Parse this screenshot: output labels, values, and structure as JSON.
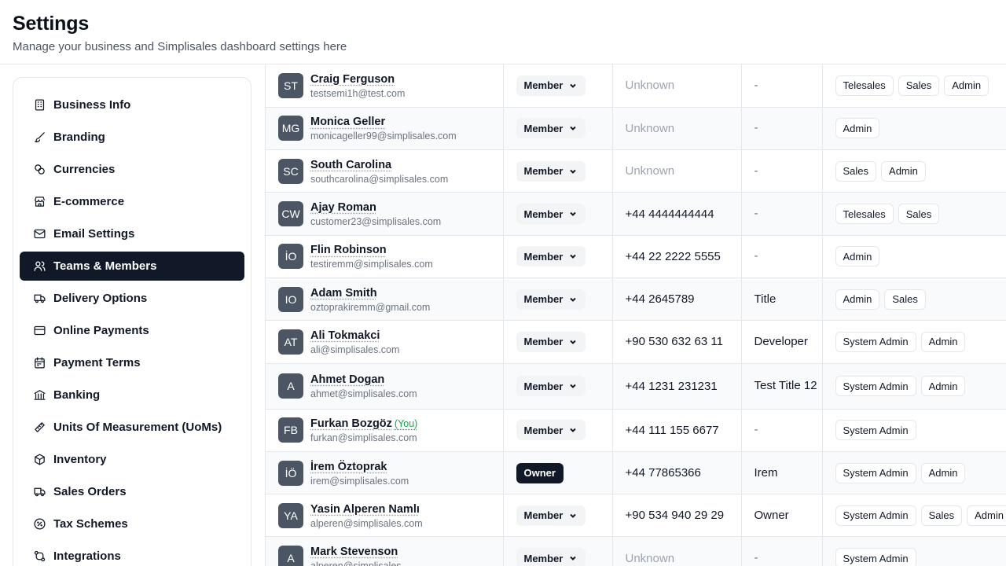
{
  "header": {
    "title": "Settings",
    "subtitle": "Manage your business and Simplisales dashboard settings here"
  },
  "sidebar": {
    "items": [
      {
        "label": "Business Info",
        "icon": "building-icon"
      },
      {
        "label": "Branding",
        "icon": "brush-icon"
      },
      {
        "label": "Currencies",
        "icon": "coins-icon"
      },
      {
        "label": "E-commerce",
        "icon": "store-icon"
      },
      {
        "label": "Email Settings",
        "icon": "mail-icon"
      },
      {
        "label": "Teams & Members",
        "icon": "users-icon",
        "active": true
      },
      {
        "label": "Delivery Options",
        "icon": "truck-icon"
      },
      {
        "label": "Online Payments",
        "icon": "credit-card-icon"
      },
      {
        "label": "Payment Terms",
        "icon": "calendar-icon"
      },
      {
        "label": "Banking",
        "icon": "bank-icon"
      },
      {
        "label": "Units Of Measurement (UoMs)",
        "icon": "ruler-icon"
      },
      {
        "label": "Inventory",
        "icon": "package-icon"
      },
      {
        "label": "Sales Orders",
        "icon": "truck-icon"
      },
      {
        "label": "Tax Schemes",
        "icon": "percent-icon"
      },
      {
        "label": "Integrations",
        "icon": "integrations-icon"
      }
    ]
  },
  "members": [
    {
      "initials": "ST",
      "name": "Craig Ferguson",
      "email": "testsemi1h@test.com",
      "role": "Member",
      "phone": "Unknown",
      "title": "-",
      "groups": [
        "Telesales",
        "Sales",
        "Admin"
      ]
    },
    {
      "initials": "MG",
      "name": "Monica Geller",
      "email": "monicageller99@simplisales.com",
      "role": "Member",
      "phone": "Unknown",
      "title": "-",
      "groups": [
        "Admin"
      ]
    },
    {
      "initials": "SC",
      "name": "South Carolina",
      "email": "southcarolina@simplisales.com",
      "role": "Member",
      "phone": "Unknown",
      "title": "-",
      "groups": [
        "Sales",
        "Admin"
      ]
    },
    {
      "initials": "CW",
      "name": "Ajay Roman",
      "email": "customer23@simplisales.com",
      "role": "Member",
      "phone": "+44 4444444444",
      "title": "-",
      "groups": [
        "Telesales",
        "Sales"
      ]
    },
    {
      "initials": "İO",
      "name": "Flin Robinson",
      "email": "testiremm@simplisales.com",
      "role": "Member",
      "phone": "+44 22 2222 5555",
      "title": "-",
      "groups": [
        "Admin"
      ]
    },
    {
      "initials": "IO",
      "name": "Adam Smith",
      "email": "oztoprakiremm@gmail.com",
      "role": "Member",
      "phone": "+44 2645789",
      "title": "Title",
      "groups": [
        "Admin",
        "Sales"
      ]
    },
    {
      "initials": "AT",
      "name": "Ali Tokmakci",
      "email": "ali@simplisales.com",
      "role": "Member",
      "phone": "+90 530 632 63 11",
      "title": "Developer",
      "groups": [
        "System Admin",
        "Admin"
      ]
    },
    {
      "initials": "A",
      "name": "Ahmet Dogan",
      "email": "ahmet@simplisales.com",
      "role": "Member",
      "phone": "+44 1231 231231",
      "title": "Test Title 12",
      "groups": [
        "System Admin",
        "Admin"
      ]
    },
    {
      "initials": "FB",
      "name": "Furkan Bozgöz",
      "you_label": "(You)",
      "email": "furkan@simplisales.com",
      "role": "Member",
      "phone": "+44 111 155 6677",
      "title": "-",
      "groups": [
        "System Admin"
      ]
    },
    {
      "initials": "İÖ",
      "name": "İrem Öztoprak",
      "email": "irem@simplisales.com",
      "role": "Owner",
      "phone": "+44 77865366",
      "title": "Irem",
      "groups": [
        "System Admin",
        "Admin"
      ]
    },
    {
      "initials": "YA",
      "name": "Yasin Alperen Namlı",
      "email": "alperen@simplisales.com",
      "role": "Member",
      "phone": "+90 534 940 29 29",
      "title": "Owner",
      "groups": [
        "System Admin",
        "Sales",
        "Admin"
      ]
    },
    {
      "initials": "A",
      "name": "Mark Stevenson",
      "email": "alperen@simplisales",
      "role": "Member",
      "phone": "Unknown",
      "title": "-",
      "groups": [
        "System Admin"
      ]
    }
  ]
}
